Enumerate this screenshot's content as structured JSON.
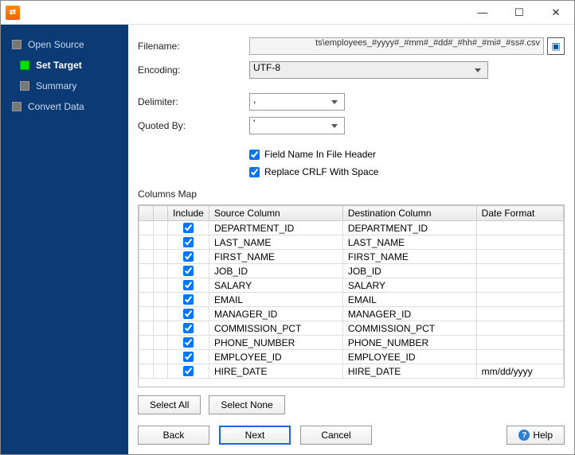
{
  "sidebar": {
    "items": [
      {
        "label": "Open Source",
        "active": false,
        "child": false
      },
      {
        "label": "Set Target",
        "active": true,
        "child": true
      },
      {
        "label": "Summary",
        "active": false,
        "child": true
      },
      {
        "label": "Convert Data",
        "active": false,
        "child": false
      }
    ]
  },
  "form": {
    "filename_label": "Filename:",
    "filename_value": "ts\\employees_#yyyy#_#mm#_#dd#_#hh#_#mi#_#ss#.csv",
    "encoding_label": "Encoding:",
    "encoding_value": "UTF-8",
    "delimiter_label": "Delimiter:",
    "delimiter_value": ",",
    "quoted_by_label": "Quoted By:",
    "quoted_by_value": "'",
    "field_name_header_label": "Field Name In File Header",
    "replace_crlf_label": "Replace CRLF With Space"
  },
  "columns_map": {
    "title": "Columns Map",
    "headers": {
      "include": "Include",
      "source": "Source Column",
      "destination": "Destination Column",
      "date_format": "Date Format"
    },
    "rows": [
      {
        "include": true,
        "source": "DEPARTMENT_ID",
        "destination": "DEPARTMENT_ID",
        "date_format": ""
      },
      {
        "include": true,
        "source": "LAST_NAME",
        "destination": "LAST_NAME",
        "date_format": ""
      },
      {
        "include": true,
        "source": "FIRST_NAME",
        "destination": "FIRST_NAME",
        "date_format": ""
      },
      {
        "include": true,
        "source": "JOB_ID",
        "destination": "JOB_ID",
        "date_format": ""
      },
      {
        "include": true,
        "source": "SALARY",
        "destination": "SALARY",
        "date_format": ""
      },
      {
        "include": true,
        "source": "EMAIL",
        "destination": "EMAIL",
        "date_format": ""
      },
      {
        "include": true,
        "source": "MANAGER_ID",
        "destination": "MANAGER_ID",
        "date_format": ""
      },
      {
        "include": true,
        "source": "COMMISSION_PCT",
        "destination": "COMMISSION_PCT",
        "date_format": ""
      },
      {
        "include": true,
        "source": "PHONE_NUMBER",
        "destination": "PHONE_NUMBER",
        "date_format": ""
      },
      {
        "include": true,
        "source": "EMPLOYEE_ID",
        "destination": "EMPLOYEE_ID",
        "date_format": ""
      },
      {
        "include": true,
        "source": "HIRE_DATE",
        "destination": "HIRE_DATE",
        "date_format": "mm/dd/yyyy"
      }
    ]
  },
  "buttons": {
    "select_all": "Select All",
    "select_none": "Select None",
    "back": "Back",
    "next": "Next",
    "cancel": "Cancel",
    "help": "Help"
  }
}
